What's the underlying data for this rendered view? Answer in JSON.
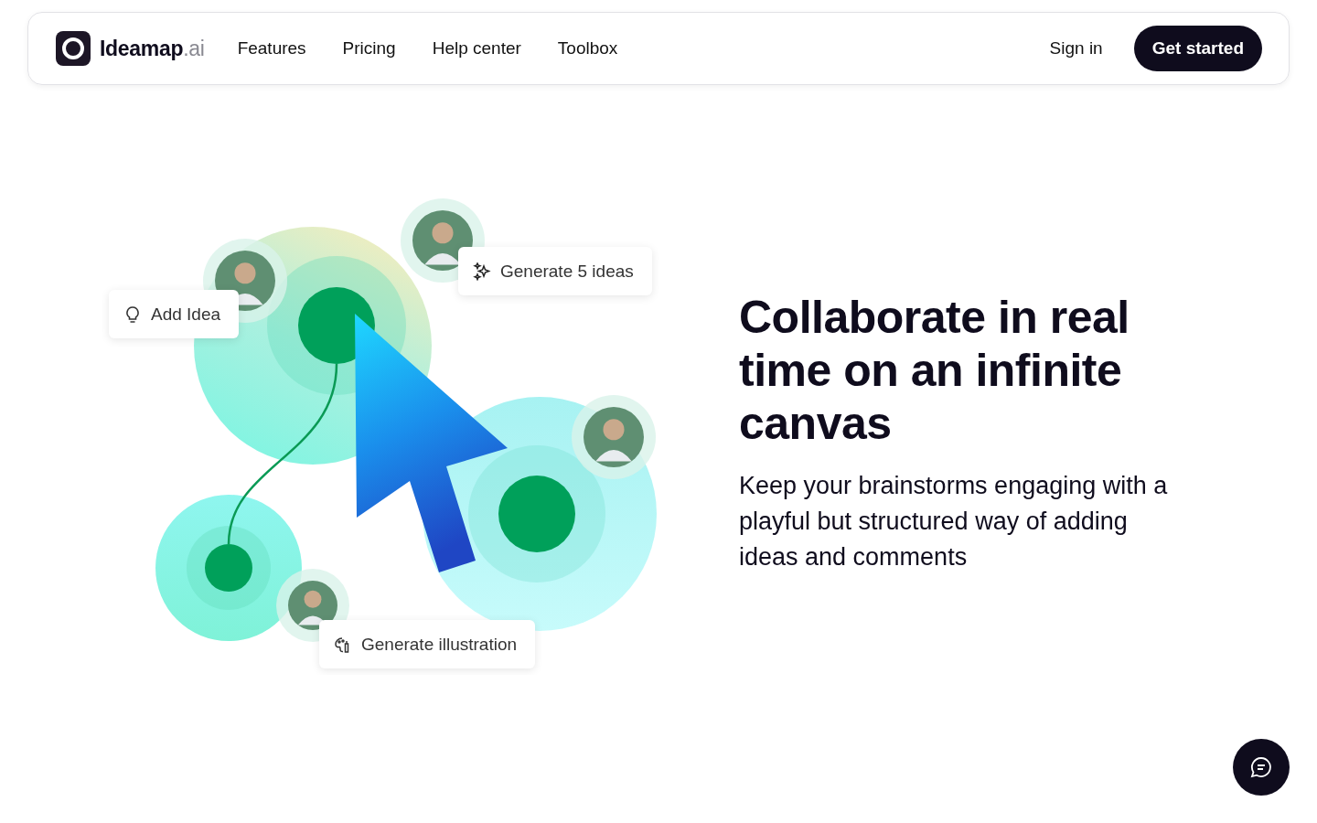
{
  "header": {
    "logo": {
      "name": "Ideamap",
      "suffix": ".ai"
    },
    "nav": [
      {
        "label": "Features"
      },
      {
        "label": "Pricing"
      },
      {
        "label": "Help center"
      },
      {
        "label": "Toolbox"
      }
    ],
    "sign_in": "Sign in",
    "cta": "Get started"
  },
  "illustration": {
    "tags": [
      {
        "kind": "idea",
        "label": "Add Idea"
      },
      {
        "kind": "sparkle",
        "label": "Generate 5 ideas"
      },
      {
        "kind": "palette",
        "label": "Generate illustration"
      }
    ]
  },
  "hero": {
    "title": "Collaborate in real time on an infinite canvas",
    "subtitle": "Keep your brainstorms engaging with a playful but structured way of adding ideas and comments"
  }
}
